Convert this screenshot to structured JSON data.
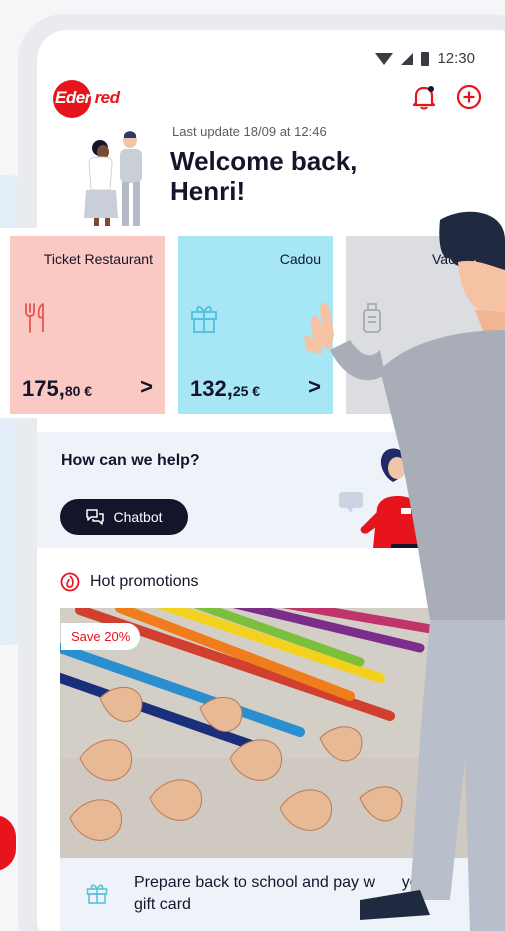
{
  "status_bar": {
    "time": "12:30"
  },
  "brand": {
    "logo_text_a": "Eden",
    "logo_text_b": "red",
    "accent_color": "#e8141c"
  },
  "header": {
    "last_update": "Last update 18/09 at 12:46",
    "welcome": "Welcome back, Henri!",
    "icons": [
      "bell-icon",
      "add-circle-icon"
    ]
  },
  "cards": [
    {
      "name": "Ticket Restaurant",
      "amount_main": "175,",
      "amount_decimals": "80 €",
      "icon": "cutlery-icon",
      "color": "#fbc9c3"
    },
    {
      "name": "Cadou",
      "amount_main": "132,",
      "amount_decimals": "25 €",
      "icon": "gift-icon",
      "color": "#a6e6f5"
    },
    {
      "name": "Vaca",
      "icon": "luggage-icon",
      "color": "#dcdde1"
    }
  ],
  "help": {
    "title": "How can we help?",
    "chatbot_label": "Chatbot"
  },
  "promotions": {
    "title": "Hot promotions",
    "badge": "Save 20%",
    "caption_a": "Prepare back to school and pay w",
    "caption_b": "your",
    "caption_c": "gift card"
  }
}
